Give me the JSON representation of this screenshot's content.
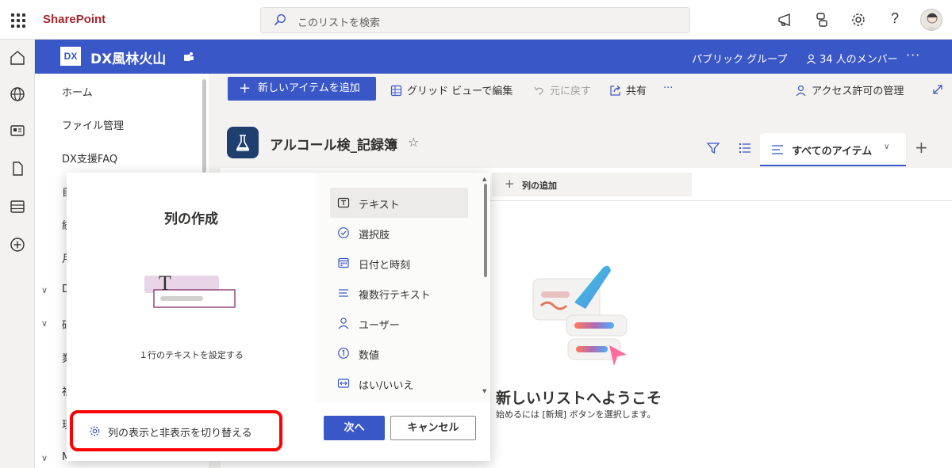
{
  "suite": {
    "brand": "SharePoint",
    "search_placeholder": "このリストを検索",
    "help_label": "?"
  },
  "site": {
    "logo_text": "DX",
    "name": "DX風林火山",
    "privacy": "パブリック グループ",
    "members": "34 人のメンバー",
    "more": "···"
  },
  "leftnav": {
    "items": [
      "ホーム",
      "ファイル管理",
      "DX支援FAQ",
      "自",
      "統",
      "月",
      "D",
      "研",
      "業",
      "社",
      "現",
      "Microsoft"
    ]
  },
  "commandbar": {
    "new_item": "新しいアイテムを追加",
    "grid_edit": "グリッド ビューで編集",
    "undo": "元に戻す",
    "share": "共有",
    "more": "···",
    "access": "アクセス許可の管理"
  },
  "list": {
    "title": "アルコール検_記録簿",
    "star": "☆",
    "view_name": "すべてのアイテム",
    "add_view": "+",
    "add_column": "列の追加",
    "welcome_title": "新しいリストへようこそ",
    "welcome_sub": "始めるには [新規] ボタンを選択します。"
  },
  "dialog": {
    "title": "列の作成",
    "illustration_letter": "T",
    "description": "１行のテキストを設定する",
    "options": [
      {
        "label": "テキスト",
        "icon": "text-icon",
        "selected": true
      },
      {
        "label": "選択肢",
        "icon": "choice-icon",
        "selected": false
      },
      {
        "label": "日付と時刻",
        "icon": "calendar-icon",
        "selected": false
      },
      {
        "label": "複数行テキスト",
        "icon": "multiline-icon",
        "selected": false
      },
      {
        "label": "ユーザー",
        "icon": "person-icon",
        "selected": false
      },
      {
        "label": "数値",
        "icon": "number-icon",
        "selected": false
      },
      {
        "label": "はい/いいえ",
        "icon": "toggle-icon",
        "selected": false
      }
    ],
    "toggle_columns": "列の表示と非表示を切り替える",
    "next": "次へ",
    "cancel": "キャンセル"
  },
  "colors": {
    "accent": "#3a57c7",
    "brand_red": "#a4262c",
    "highlight": "#ff0000"
  }
}
